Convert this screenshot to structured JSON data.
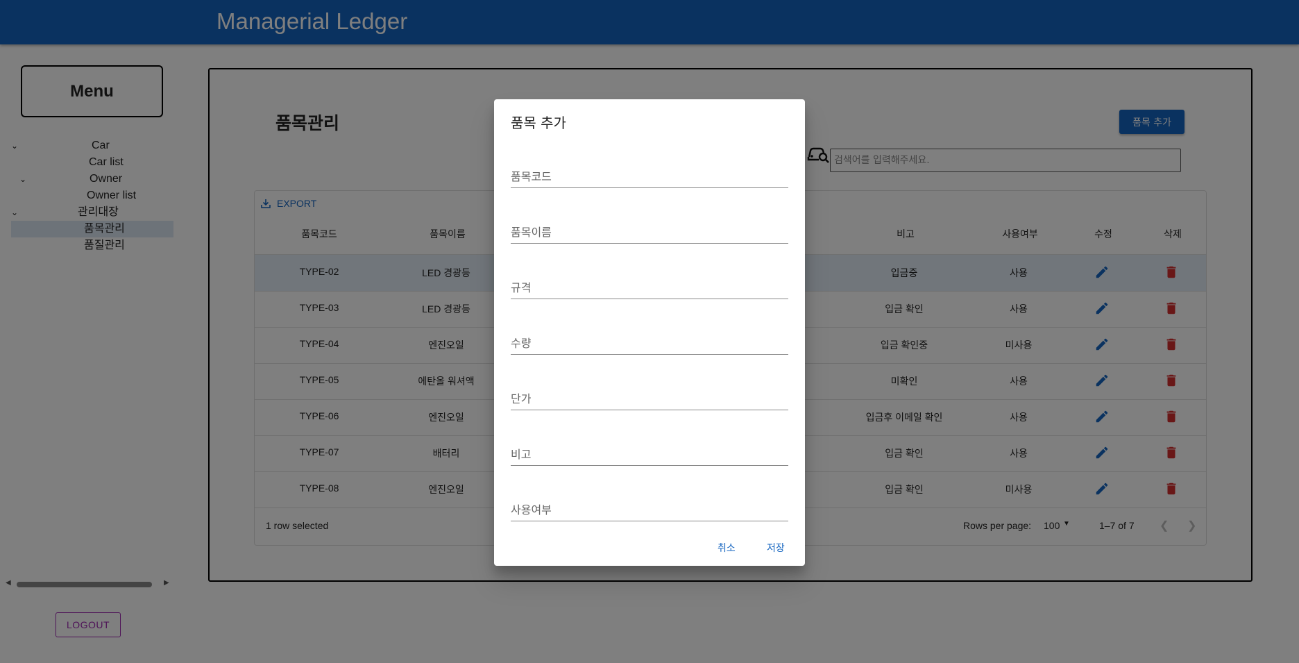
{
  "app": {
    "title": "Managerial Ledger"
  },
  "sidebar": {
    "menu_title": "Menu",
    "items": [
      {
        "label": "Car"
      },
      {
        "label": "Car list"
      },
      {
        "label": "Owner"
      },
      {
        "label": "Owner list"
      },
      {
        "label": "관리대장"
      },
      {
        "label": "품목관리"
      },
      {
        "label": "품질관리"
      }
    ],
    "logout_label": "LOGOUT"
  },
  "main": {
    "page_title": "품목관리",
    "add_button_label": "품목 추가",
    "search": {
      "placeholder": "검색어를 입력해주세요."
    },
    "grid": {
      "export_label": "EXPORT",
      "columns": [
        "품목코드",
        "품목이름",
        "비고",
        "사용여부",
        "수정",
        "삭제"
      ],
      "rows": [
        {
          "code": "TYPE-02",
          "name": "LED 경광등",
          "note": "입금중",
          "use": "사용"
        },
        {
          "code": "TYPE-03",
          "name": "LED 경광등",
          "note": "입금 확인",
          "use": "사용"
        },
        {
          "code": "TYPE-04",
          "name": "엔진오일",
          "note": "입금 확인중",
          "use": "미사용"
        },
        {
          "code": "TYPE-05",
          "name": "에탄올 워셔액",
          "note": "미확인",
          "use": "사용"
        },
        {
          "code": "TYPE-06",
          "name": "엔진오일",
          "note": "입금후 이메일 확인",
          "use": "사용"
        },
        {
          "code": "TYPE-07",
          "name": "배터리",
          "note": "입금 확인",
          "use": "사용"
        },
        {
          "code": "TYPE-08",
          "name": "엔진오일",
          "note": "입금 확인",
          "use": "미사용"
        }
      ],
      "footer": {
        "selected_text": "1 row selected",
        "rows_per_page_label": "Rows per page:",
        "rows_per_page_value": "100",
        "range_text": "1–7 of 7"
      }
    }
  },
  "dialog": {
    "title": "품목 추가",
    "fields": [
      {
        "label": "품목코드"
      },
      {
        "label": "품목이름"
      },
      {
        "label": "규격"
      },
      {
        "label": "수량"
      },
      {
        "label": "단가"
      },
      {
        "label": "비고"
      },
      {
        "label": "사용여부"
      }
    ],
    "cancel_label": "취소",
    "save_label": "저장"
  },
  "colors": {
    "primary": "#1565c0",
    "delete": "#d32f2f",
    "logout": "#9c27b0"
  }
}
